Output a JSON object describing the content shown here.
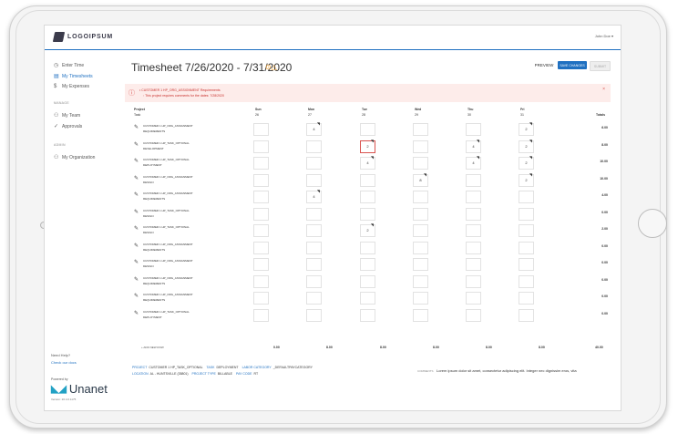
{
  "app": {
    "logo_text": "LOGOIPSUM",
    "user_menu": "John Doe ▾",
    "accent_color": "#1f70c1"
  },
  "sidebar": {
    "items": [
      {
        "label": "Enter Time",
        "icon": "clock-icon"
      },
      {
        "label": "My Timesheets",
        "icon": "timesheet-icon"
      },
      {
        "label": "My Expenses",
        "icon": "dollar-icon"
      }
    ],
    "manage_heading": "MANAGE",
    "manage_items": [
      {
        "label": "My Team",
        "icon": "team-icon"
      },
      {
        "label": "Approvals",
        "icon": "check-icon"
      }
    ],
    "admin_heading": "ADMIN",
    "admin_items": [
      {
        "label": "My Organization",
        "icon": "org-icon"
      }
    ],
    "help_text": "Need Help?",
    "help_link": "Check our docs",
    "powered_by": "Powered by",
    "brand": "Unanet",
    "version": "Version: 20.4.0.1175"
  },
  "header": {
    "title": "Timesheet 7/26/2020 - 7/31/2020",
    "preview_label": "PREVIEW",
    "save_label": "SAVE CHANGES",
    "submit_label": "SUBMIT"
  },
  "alert": {
    "line1": "CUSTOMER 1 HP_ORG_ASSIGNMENT Requirements",
    "line2": "This project requires comments for the dates: 7/28/2020",
    "close": "×"
  },
  "grid": {
    "project_header": "Project",
    "task_header": "Task",
    "totals_header": "Totals",
    "days": [
      {
        "name": "Sun",
        "date": "26"
      },
      {
        "name": "Mon",
        "date": "27"
      },
      {
        "name": "Tue",
        "date": "28"
      },
      {
        "name": "Wed",
        "date": "29"
      },
      {
        "name": "Thu",
        "date": "30"
      },
      {
        "name": "Fri",
        "date": "31"
      }
    ],
    "rows": [
      {
        "project": "CUSTOMER 1 HP_ORG_ASSIGNMENT",
        "task": "REQUIREMENTS",
        "hours": [
          "",
          "4",
          "",
          "",
          "",
          "2"
        ],
        "total": "6.00"
      },
      {
        "project": "CUSTOMER 1 HP_TASK_OPTIONAL",
        "task": "DEVELOPMENT",
        "hours": [
          "",
          "",
          "2",
          "",
          "4",
          "2"
        ],
        "total": "8.00"
      },
      {
        "project": "CUSTOMER 1 HP_TASK_OPTIONAL",
        "task": "DEPLOYMENT",
        "hours": [
          "",
          "",
          "4",
          "",
          "4",
          "2"
        ],
        "total": "10.00"
      },
      {
        "project": "CUSTOMER 1 HP_ORG_ASSIGNMENT",
        "task": "DESIGN",
        "hours": [
          "",
          "",
          "",
          "8",
          "",
          "2"
        ],
        "total": "10.00"
      },
      {
        "project": "CUSTOMER 1 HP_ORG_ASSIGNMENT",
        "task": "REQUIREMENTS",
        "hours": [
          "",
          "4",
          "",
          "",
          "",
          ""
        ],
        "total": "4.00"
      },
      {
        "project": "CUSTOMER 1 HP_TASK_OPTIONAL",
        "task": "DESIGN",
        "hours": [
          "",
          "",
          "",
          "",
          "",
          ""
        ],
        "total": "0.00"
      },
      {
        "project": "CUSTOMER 1 HP_TASK_OPTIONAL",
        "task": "DESIGN",
        "hours": [
          "",
          "",
          "2",
          "",
          "",
          ""
        ],
        "total": "2.00"
      },
      {
        "project": "CUSTOMER 1 HP_ORG_ASSIGNMENT",
        "task": "REQUIREMENTS",
        "hours": [
          "",
          "",
          "",
          "",
          "",
          ""
        ],
        "total": "0.00"
      },
      {
        "project": "CUSTOMER 1 HP_ORG_ASSIGNMENT",
        "task": "DESIGN",
        "hours": [
          "",
          "",
          "",
          "",
          "",
          ""
        ],
        "total": "0.00"
      },
      {
        "project": "CUSTOMER 1 HP_ORG_ASSIGNMENT",
        "task": "REQUIREMENTS",
        "hours": [
          "",
          "",
          "",
          "",
          "",
          ""
        ],
        "total": "0.00"
      },
      {
        "project": "CUSTOMER 1 HP_ORG_ASSIGNMENT",
        "task": "REQUIREMENTS",
        "hours": [
          "",
          "",
          "",
          "",
          "",
          ""
        ],
        "total": "0.00"
      },
      {
        "project": "CUSTOMER 1 HP_TASK_OPTIONAL",
        "task": "DEPLOYMENT",
        "hours": [
          "",
          "",
          "",
          "",
          "",
          ""
        ],
        "total": "0.00"
      }
    ],
    "add_row_label": "+ ADD NEW ROW",
    "day_totals": [
      "0.00",
      "8.00",
      "8.00",
      "8.00",
      "8.00",
      "8.00"
    ],
    "grand_total": "40.00"
  },
  "details": {
    "line1": [
      {
        "key": "PROJECT",
        "value": "CUSTOMER 1 HP_TASK_OPTIONAL"
      },
      {
        "key": "TASK",
        "value": "DEPLOYMENT"
      },
      {
        "key": "LABOR CATEGORY",
        "value": "_DEFAULTPAYCATEGORY"
      }
    ],
    "line2": [
      {
        "key": "LOCATION",
        "value": "AL - HUNTSVILLE (35801)"
      },
      {
        "key": "PROJECT TYPE",
        "value": "BILLABLE"
      },
      {
        "key": "PAY CODE",
        "value": "RT"
      }
    ],
    "comments_label": "COMMENTS",
    "comments_value": "Lorem ipsum dolor sit amet, consectetur adipiscing elit. Integer nec dignissim eros, vita"
  }
}
